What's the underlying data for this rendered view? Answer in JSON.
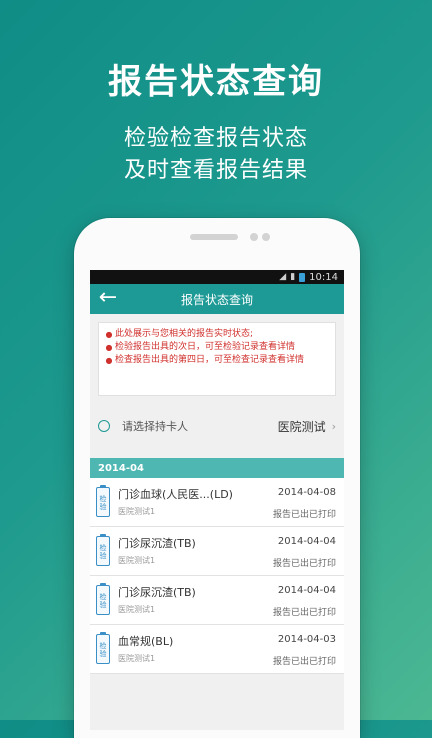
{
  "hero": {
    "title": "报告状态查询",
    "subtitle_line1": "检验检查报告状态",
    "subtitle_line2": "及时查看报告结果"
  },
  "statusbar": {
    "time": "10:14"
  },
  "app": {
    "title": "报告状态查询",
    "notice": [
      "此处展示与您相关的报告实时状态;",
      "检验报告出具的次日，可至检验记录查看详情",
      "检查报告出具的第四日，可至检查记录查看详情"
    ],
    "cardholder": {
      "label": "请选择持卡人",
      "value": "医院测试"
    },
    "date_group": "2014-04",
    "reports": [
      {
        "icon_text": "检验",
        "name": "门诊血球(人民医...(LD)",
        "hospital": "医院测试1",
        "date": "2014-04-08",
        "status": "报告已出已打印"
      },
      {
        "icon_text": "检验",
        "name": "门诊尿沉渣(TB)",
        "hospital": "医院测试1",
        "date": "2014-04-04",
        "status": "报告已出已打印"
      },
      {
        "icon_text": "检验",
        "name": "门诊尿沉渣(TB)",
        "hospital": "医院测试1",
        "date": "2014-04-04",
        "status": "报告已出已打印"
      },
      {
        "icon_text": "检验",
        "name": "血常规(BL)",
        "hospital": "医院测试1",
        "date": "2014-04-03",
        "status": "报告已出已打印"
      }
    ]
  },
  "colors": {
    "accent": "#1e9a96",
    "notice_text": "#d0312d",
    "date_header": "#4fb7b2"
  }
}
